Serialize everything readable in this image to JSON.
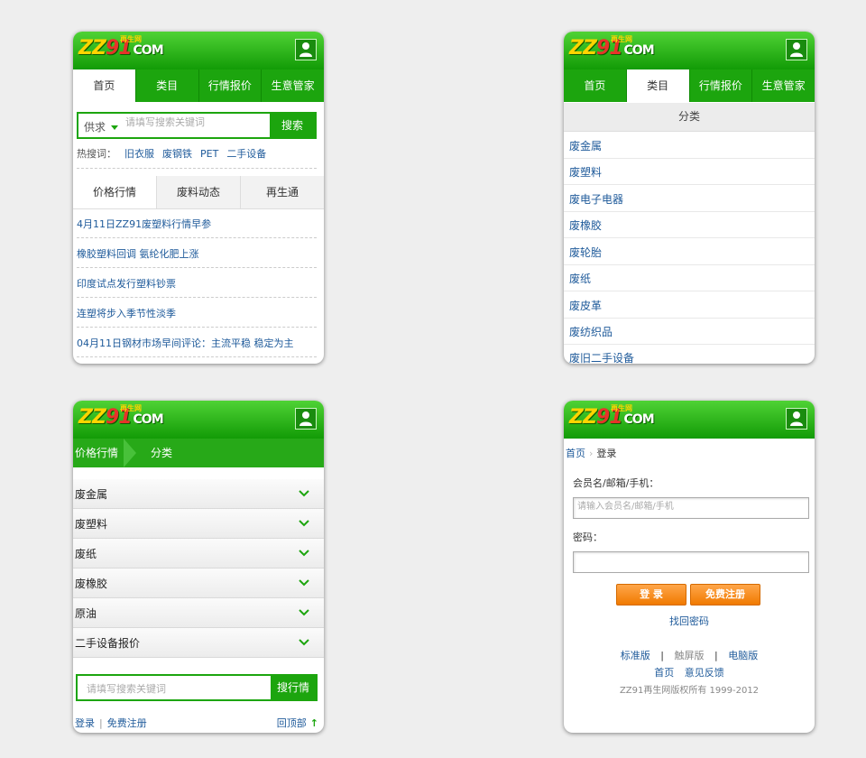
{
  "brand": {
    "logo_zz": "ZZ",
    "logo_91": "91",
    "logo_com": "COM",
    "logo_tag": "再生网"
  },
  "accent": "#1ca50e",
  "screen1": {
    "nav": [
      "首页",
      "类目",
      "行情报价",
      "生意管家"
    ],
    "search_type": "供求",
    "search_placeholder": "请填写搜索关键词",
    "search_button": "搜索",
    "hot_label": "热搜词：",
    "hot_words": [
      "旧衣服",
      "废钢铁",
      "PET",
      "二手设备"
    ],
    "tabs": [
      "价格行情",
      "废料动态",
      "再生通"
    ],
    "news": [
      "4月11日ZZ91废塑料行情早参",
      "橡胶塑料回调 氨纶化肥上涨",
      "印度试点发行塑料钞票",
      "连塑将步入季节性淡季",
      "04月11日钢材市场早间评论：主流平稳 稳定为主"
    ]
  },
  "screen2": {
    "nav": [
      "首页",
      "类目",
      "行情报价",
      "生意管家"
    ],
    "section_title": "分类",
    "categories": [
      "废金属",
      "废塑料",
      "废电子电器",
      "废橡胶",
      "废轮胎",
      "废纸",
      "废皮革",
      "废纺织品",
      "废旧二手设备"
    ]
  },
  "screen3": {
    "crumb_first": "价格行情",
    "crumb_second": "分类",
    "accordion": [
      "废金属",
      "废塑料",
      "废纸",
      "废橡胶",
      "原油",
      "二手设备报价"
    ],
    "search_placeholder": "请填写搜索关键词",
    "search_button": "搜行情",
    "login": "登录",
    "register": "免费注册",
    "back_top": "回顶部"
  },
  "screen4": {
    "crumb_home": "首页",
    "crumb_current": "登录",
    "user_label": "会员名/邮箱/手机：",
    "user_placeholder": "请输入会员名/邮箱/手机",
    "password_label": "密码：",
    "login_button": "登 录",
    "register_button": "免费注册",
    "forgot": "找回密码",
    "versions": [
      "标准版",
      "触屏版",
      "电脑版"
    ],
    "links": [
      "首页",
      "意见反馈"
    ],
    "copyright": "ZZ91再生网版权所有 1999-2012"
  }
}
